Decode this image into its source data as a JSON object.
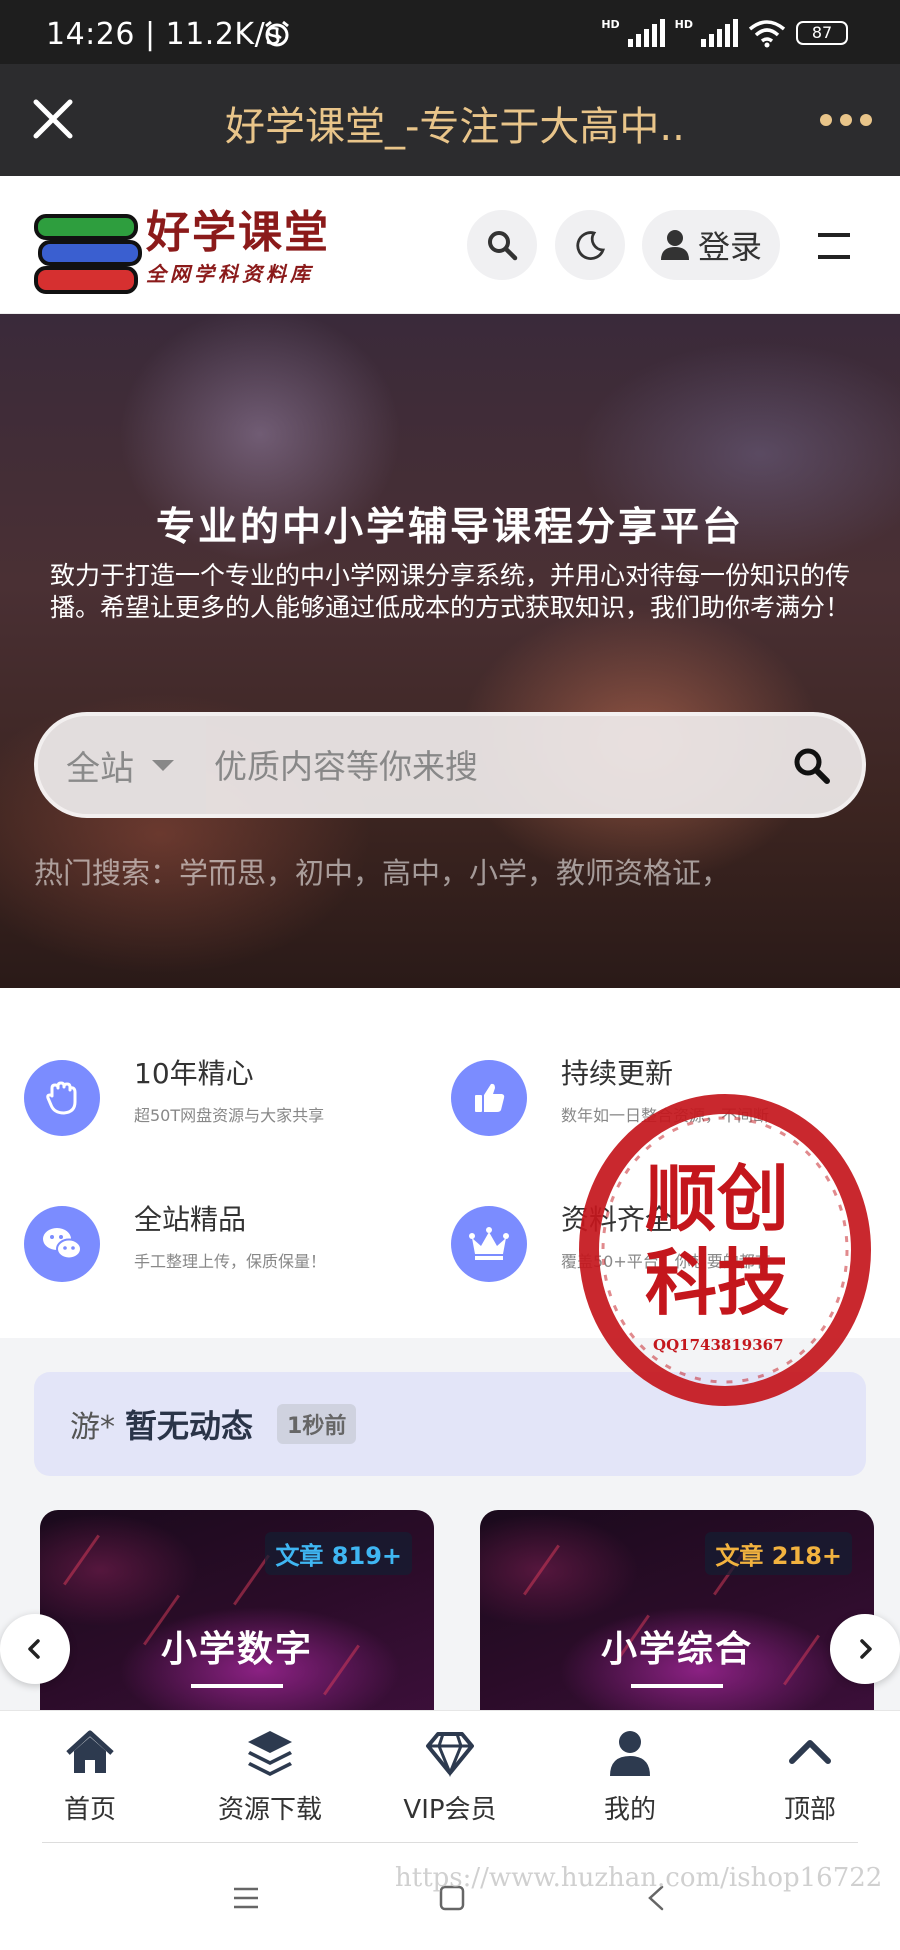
{
  "status_bar": {
    "time": "14:26 | 11.2K/s",
    "hd": "HD",
    "battery": "87"
  },
  "titlebar": {
    "title": "好学课堂_-专注于大高中..."
  },
  "header": {
    "logo_title": "好学课堂",
    "logo_subtitle": "全网学科资料库",
    "login_label": "登录"
  },
  "hero": {
    "title": "专业的中小学辅导课程分享平台",
    "description": "致力于打造一个专业的中小学网课分享系统，并用心对待每一份知识的传播。希望让更多的人能够通过低成本的方式获取知识，我们助你考满分！",
    "search_scope": "全站",
    "search_placeholder": "优质内容等你来搜",
    "hot_search": "热门搜索：学而思，初中，高中，小学，教师资格证，"
  },
  "features": [
    {
      "title": "10年精心",
      "desc": "超50T网盘资源与大家共享",
      "icon": "hand-icon"
    },
    {
      "title": "持续更新",
      "desc": "数年如一日整合资源，不间断",
      "icon": "thumbs-up-icon"
    },
    {
      "title": "全站精品",
      "desc": "手工整理上传，保质保量！",
      "icon": "wechat-icon"
    },
    {
      "title": "资料齐全",
      "desc": "覆盖50+平台，你想要的都有",
      "icon": "crown-icon"
    }
  ],
  "activity": {
    "user": "游*",
    "text": "暂无动态",
    "time": "1秒前"
  },
  "cards": [
    {
      "title": "小学数字",
      "badge": "文章 819+",
      "badge_color": "#3fb6f2"
    },
    {
      "title": "小学综合",
      "badge": "文章 218+",
      "badge_color": "#f2b23f"
    }
  ],
  "stamp": {
    "line1": "顺创",
    "line2": "科技",
    "qq": "QQ1743819367"
  },
  "bottom_nav": [
    {
      "label": "首页",
      "icon": "home-icon"
    },
    {
      "label": "资源下载",
      "icon": "layers-icon"
    },
    {
      "label": "VIP会员",
      "icon": "diamond-icon"
    },
    {
      "label": "我的",
      "icon": "user-icon"
    },
    {
      "label": "顶部",
      "icon": "chevron-up-icon"
    }
  ],
  "watermark_url": "https://www.huzhan.com/ishop16722",
  "colors": {
    "accent": "#7b8cff",
    "title_gold": "#e9c58a",
    "logo_red": "#8b1a1a",
    "stamp_red": "#c4161c"
  }
}
